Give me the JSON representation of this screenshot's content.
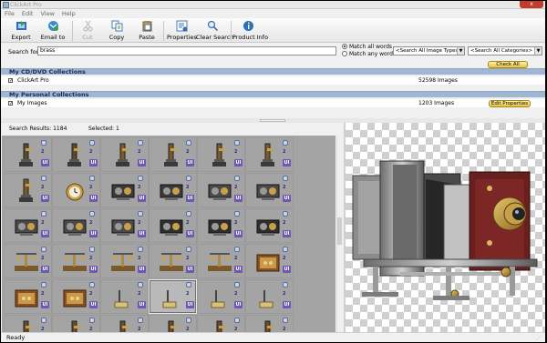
{
  "window": {
    "title": "ClickArt Pro",
    "close_glyph": "x"
  },
  "menu": [
    "File",
    "Edit",
    "View",
    "Help"
  ],
  "toolbar": [
    {
      "key": "export",
      "label": "Export",
      "icon": "export-icon",
      "enabled": true
    },
    {
      "key": "email",
      "label": "Email to",
      "icon": "email-icon",
      "enabled": true
    },
    {
      "key": "cut",
      "label": "Cut",
      "icon": "cut-icon",
      "enabled": false
    },
    {
      "key": "copy",
      "label": "Copy",
      "icon": "copy-icon",
      "enabled": true
    },
    {
      "key": "paste",
      "label": "Paste",
      "icon": "paste-icon",
      "enabled": true
    },
    {
      "key": "properties",
      "label": "Properties",
      "icon": "properties-icon",
      "enabled": true
    },
    {
      "key": "clear_search",
      "label": "Clear Search",
      "icon": "clear-search-icon",
      "enabled": true
    },
    {
      "key": "product_info",
      "label": "Product Info",
      "icon": "info-icon",
      "enabled": true
    }
  ],
  "search": {
    "label": "Search for:",
    "value": "brass",
    "match_all": "Match all words",
    "match_any": "Match any word",
    "match_mode": "all",
    "image_types": "<Search All Image Types>",
    "categories": "<Search All Categories>",
    "check_all": "Check All"
  },
  "cd_collections": {
    "title": "My CD/DVD Collections",
    "items": [
      {
        "name": "ClickArt Pro",
        "count": "52598 Images",
        "checked": true
      }
    ]
  },
  "personal_collections": {
    "title": "My Personal Collections",
    "items": [
      {
        "name": "My Images",
        "count": "1203 Images",
        "checked": true
      }
    ],
    "edit_properties": "Edit Properties"
  },
  "results": {
    "label": "Search Results: 1184",
    "selected_label": "Selected: 1",
    "badge": "2",
    "ui_badge": "UI",
    "selected_index": 27,
    "thumbnails": [
      "telescope",
      "telescope",
      "microscope",
      "microscope",
      "microscope",
      "microscope",
      "microscope",
      "pocket-watch",
      "navigation-instrument",
      "navigation-instrument",
      "sextant",
      "sextant",
      "sextant",
      "sextant",
      "sextant",
      "camera",
      "camera",
      "camera",
      "scale",
      "scale",
      "scale",
      "scale",
      "scale",
      "wooden-box",
      "wooden-box",
      "wooden-box",
      "weight",
      "weight",
      "weight",
      "weight",
      "instrument",
      "instrument",
      "instrument",
      "instrument",
      "instrument",
      "instrument"
    ]
  },
  "preview": {
    "subject": "antique brass camera"
  },
  "status": {
    "text": "Ready"
  },
  "colors": {
    "section_header": "#9fb7d2",
    "gold_button": "#e6c23a",
    "ui_badge": "#6f58b3",
    "grid_bg": "#a4a4a4"
  }
}
